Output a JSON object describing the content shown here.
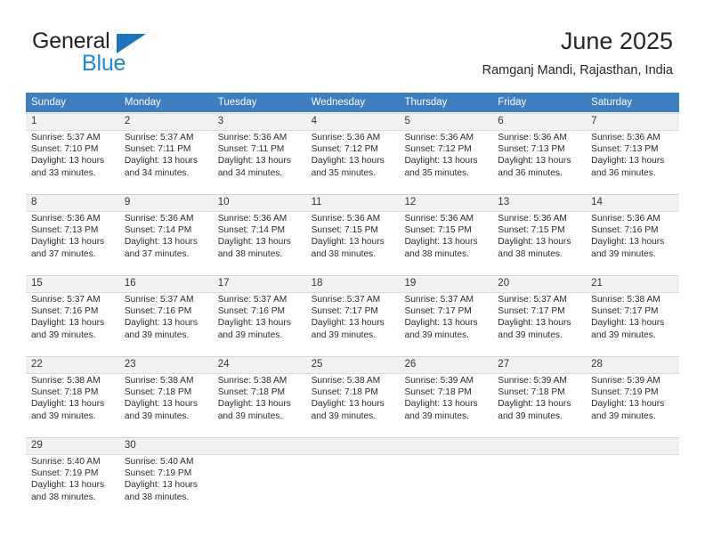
{
  "brand": {
    "name_line1": "General",
    "name_line2": "Blue",
    "triangle_color": "#1c75bc",
    "blue_color": "#1c87d6"
  },
  "header": {
    "title": "June 2025",
    "subtitle": "Ramganj Mandi, Rajasthan, India"
  },
  "theme": {
    "header_bg": "#3c7ebf",
    "daynum_band_bg": "#f1f1f1",
    "text": "#2b2b2b"
  },
  "weekdays": [
    "Sunday",
    "Monday",
    "Tuesday",
    "Wednesday",
    "Thursday",
    "Friday",
    "Saturday"
  ],
  "weeks": [
    [
      {
        "day": "1",
        "sunrise": "Sunrise: 5:37 AM",
        "sunset": "Sunset: 7:10 PM",
        "daylight1": "Daylight: 13 hours",
        "daylight2": "and 33 minutes."
      },
      {
        "day": "2",
        "sunrise": "Sunrise: 5:37 AM",
        "sunset": "Sunset: 7:11 PM",
        "daylight1": "Daylight: 13 hours",
        "daylight2": "and 34 minutes."
      },
      {
        "day": "3",
        "sunrise": "Sunrise: 5:36 AM",
        "sunset": "Sunset: 7:11 PM",
        "daylight1": "Daylight: 13 hours",
        "daylight2": "and 34 minutes."
      },
      {
        "day": "4",
        "sunrise": "Sunrise: 5:36 AM",
        "sunset": "Sunset: 7:12 PM",
        "daylight1": "Daylight: 13 hours",
        "daylight2": "and 35 minutes."
      },
      {
        "day": "5",
        "sunrise": "Sunrise: 5:36 AM",
        "sunset": "Sunset: 7:12 PM",
        "daylight1": "Daylight: 13 hours",
        "daylight2": "and 35 minutes."
      },
      {
        "day": "6",
        "sunrise": "Sunrise: 5:36 AM",
        "sunset": "Sunset: 7:13 PM",
        "daylight1": "Daylight: 13 hours",
        "daylight2": "and 36 minutes."
      },
      {
        "day": "7",
        "sunrise": "Sunrise: 5:36 AM",
        "sunset": "Sunset: 7:13 PM",
        "daylight1": "Daylight: 13 hours",
        "daylight2": "and 36 minutes."
      }
    ],
    [
      {
        "day": "8",
        "sunrise": "Sunrise: 5:36 AM",
        "sunset": "Sunset: 7:13 PM",
        "daylight1": "Daylight: 13 hours",
        "daylight2": "and 37 minutes."
      },
      {
        "day": "9",
        "sunrise": "Sunrise: 5:36 AM",
        "sunset": "Sunset: 7:14 PM",
        "daylight1": "Daylight: 13 hours",
        "daylight2": "and 37 minutes."
      },
      {
        "day": "10",
        "sunrise": "Sunrise: 5:36 AM",
        "sunset": "Sunset: 7:14 PM",
        "daylight1": "Daylight: 13 hours",
        "daylight2": "and 38 minutes."
      },
      {
        "day": "11",
        "sunrise": "Sunrise: 5:36 AM",
        "sunset": "Sunset: 7:15 PM",
        "daylight1": "Daylight: 13 hours",
        "daylight2": "and 38 minutes."
      },
      {
        "day": "12",
        "sunrise": "Sunrise: 5:36 AM",
        "sunset": "Sunset: 7:15 PM",
        "daylight1": "Daylight: 13 hours",
        "daylight2": "and 38 minutes."
      },
      {
        "day": "13",
        "sunrise": "Sunrise: 5:36 AM",
        "sunset": "Sunset: 7:15 PM",
        "daylight1": "Daylight: 13 hours",
        "daylight2": "and 38 minutes."
      },
      {
        "day": "14",
        "sunrise": "Sunrise: 5:36 AM",
        "sunset": "Sunset: 7:16 PM",
        "daylight1": "Daylight: 13 hours",
        "daylight2": "and 39 minutes."
      }
    ],
    [
      {
        "day": "15",
        "sunrise": "Sunrise: 5:37 AM",
        "sunset": "Sunset: 7:16 PM",
        "daylight1": "Daylight: 13 hours",
        "daylight2": "and 39 minutes."
      },
      {
        "day": "16",
        "sunrise": "Sunrise: 5:37 AM",
        "sunset": "Sunset: 7:16 PM",
        "daylight1": "Daylight: 13 hours",
        "daylight2": "and 39 minutes."
      },
      {
        "day": "17",
        "sunrise": "Sunrise: 5:37 AM",
        "sunset": "Sunset: 7:16 PM",
        "daylight1": "Daylight: 13 hours",
        "daylight2": "and 39 minutes."
      },
      {
        "day": "18",
        "sunrise": "Sunrise: 5:37 AM",
        "sunset": "Sunset: 7:17 PM",
        "daylight1": "Daylight: 13 hours",
        "daylight2": "and 39 minutes."
      },
      {
        "day": "19",
        "sunrise": "Sunrise: 5:37 AM",
        "sunset": "Sunset: 7:17 PM",
        "daylight1": "Daylight: 13 hours",
        "daylight2": "and 39 minutes."
      },
      {
        "day": "20",
        "sunrise": "Sunrise: 5:37 AM",
        "sunset": "Sunset: 7:17 PM",
        "daylight1": "Daylight: 13 hours",
        "daylight2": "and 39 minutes."
      },
      {
        "day": "21",
        "sunrise": "Sunrise: 5:38 AM",
        "sunset": "Sunset: 7:17 PM",
        "daylight1": "Daylight: 13 hours",
        "daylight2": "and 39 minutes."
      }
    ],
    [
      {
        "day": "22",
        "sunrise": "Sunrise: 5:38 AM",
        "sunset": "Sunset: 7:18 PM",
        "daylight1": "Daylight: 13 hours",
        "daylight2": "and 39 minutes."
      },
      {
        "day": "23",
        "sunrise": "Sunrise: 5:38 AM",
        "sunset": "Sunset: 7:18 PM",
        "daylight1": "Daylight: 13 hours",
        "daylight2": "and 39 minutes."
      },
      {
        "day": "24",
        "sunrise": "Sunrise: 5:38 AM",
        "sunset": "Sunset: 7:18 PM",
        "daylight1": "Daylight: 13 hours",
        "daylight2": "and 39 minutes."
      },
      {
        "day": "25",
        "sunrise": "Sunrise: 5:38 AM",
        "sunset": "Sunset: 7:18 PM",
        "daylight1": "Daylight: 13 hours",
        "daylight2": "and 39 minutes."
      },
      {
        "day": "26",
        "sunrise": "Sunrise: 5:39 AM",
        "sunset": "Sunset: 7:18 PM",
        "daylight1": "Daylight: 13 hours",
        "daylight2": "and 39 minutes."
      },
      {
        "day": "27",
        "sunrise": "Sunrise: 5:39 AM",
        "sunset": "Sunset: 7:18 PM",
        "daylight1": "Daylight: 13 hours",
        "daylight2": "and 39 minutes."
      },
      {
        "day": "28",
        "sunrise": "Sunrise: 5:39 AM",
        "sunset": "Sunset: 7:19 PM",
        "daylight1": "Daylight: 13 hours",
        "daylight2": "and 39 minutes."
      }
    ],
    [
      {
        "day": "29",
        "sunrise": "Sunrise: 5:40 AM",
        "sunset": "Sunset: 7:19 PM",
        "daylight1": "Daylight: 13 hours",
        "daylight2": "and 38 minutes."
      },
      {
        "day": "30",
        "sunrise": "Sunrise: 5:40 AM",
        "sunset": "Sunset: 7:19 PM",
        "daylight1": "Daylight: 13 hours",
        "daylight2": "and 38 minutes."
      },
      {
        "day": "",
        "sunrise": "",
        "sunset": "",
        "daylight1": "",
        "daylight2": ""
      },
      {
        "day": "",
        "sunrise": "",
        "sunset": "",
        "daylight1": "",
        "daylight2": ""
      },
      {
        "day": "",
        "sunrise": "",
        "sunset": "",
        "daylight1": "",
        "daylight2": ""
      },
      {
        "day": "",
        "sunrise": "",
        "sunset": "",
        "daylight1": "",
        "daylight2": ""
      },
      {
        "day": "",
        "sunrise": "",
        "sunset": "",
        "daylight1": "",
        "daylight2": ""
      }
    ]
  ]
}
